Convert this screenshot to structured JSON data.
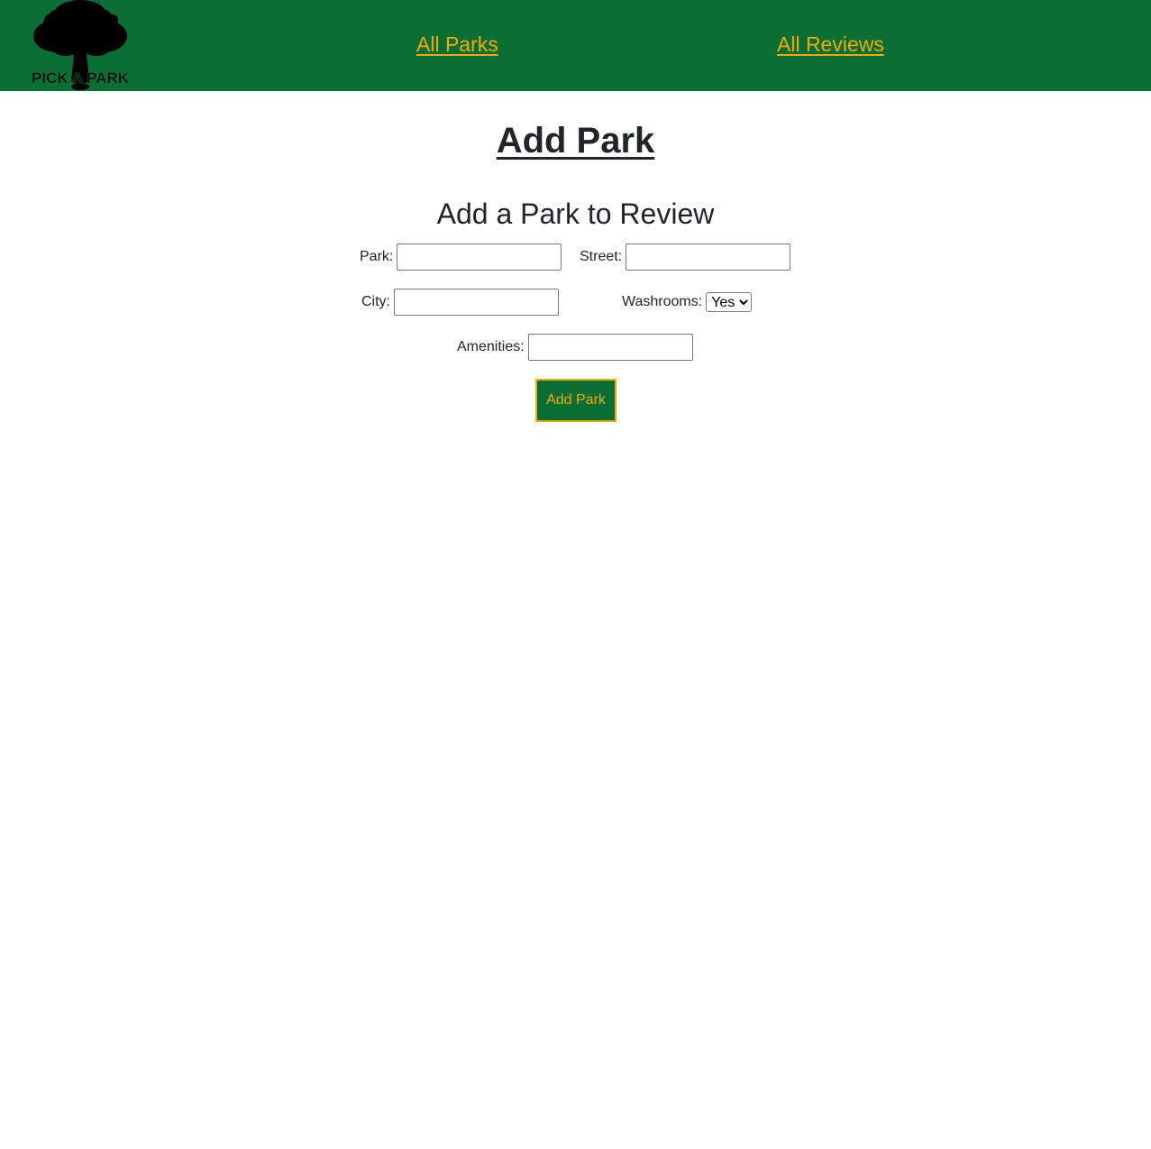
{
  "nav": {
    "logo_text": "PICK A PARK",
    "links": [
      {
        "label": "All Parks"
      },
      {
        "label": "All Reviews"
      }
    ]
  },
  "page": {
    "title": "Add Park"
  },
  "form": {
    "title": "Add a Park to Review",
    "park_label": "Park:",
    "park_value": "",
    "street_label": "Street:",
    "street_value": "",
    "city_label": "City:",
    "city_value": "",
    "washrooms_label": "Washrooms:",
    "washrooms_selected": "Yes",
    "amenities_label": "Amenities:",
    "amenities_value": "",
    "submit_label": "Add Park"
  },
  "colors": {
    "nav_background": "#0b6e35",
    "accent": "#f0ab00",
    "text": "#212529"
  }
}
